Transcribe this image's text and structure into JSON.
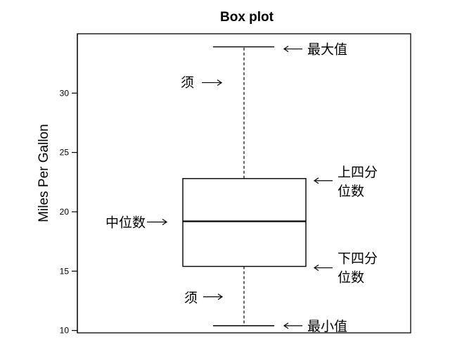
{
  "chart_data": {
    "type": "boxplot",
    "title": "Box plot",
    "xlabel": "",
    "ylabel": "Miles Per Gallon",
    "ylim": [
      9.8,
      35
    ],
    "yticks": [
      10,
      15,
      20,
      25,
      30
    ],
    "grid": false,
    "box": {
      "min": 10.4,
      "q1": 15.4,
      "median": 19.2,
      "q3": 22.8,
      "max": 33.9,
      "whisker_low": 10.4,
      "whisker_high": 33.9
    },
    "annotations": [
      {
        "id": "max",
        "text": "最大值",
        "arrow": "←",
        "y": 33.9
      },
      {
        "id": "upper-whisker",
        "text": "须",
        "arrow": "→",
        "y": 31.0
      },
      {
        "id": "q3",
        "lines": [
          "上四分",
          "位数"
        ],
        "arrow": "←",
        "y": 22.8
      },
      {
        "id": "median",
        "text": "中位数",
        "arrow": "→",
        "y": 19.2
      },
      {
        "id": "q1",
        "lines": [
          "下四分",
          "位数"
        ],
        "arrow": "←",
        "y": 15.4
      },
      {
        "id": "lower-whisker",
        "text": "须",
        "arrow": "→",
        "y": 12.9
      },
      {
        "id": "min",
        "text": "最小值",
        "arrow": "←",
        "y": 10.4
      }
    ]
  }
}
